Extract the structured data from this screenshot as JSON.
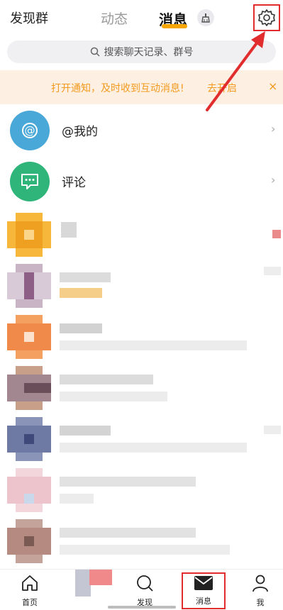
{
  "header": {
    "left_title": "发现群",
    "tab_dynamic": "动态",
    "tab_messages": "消息"
  },
  "search": {
    "placeholder": "搜索聊天记录、群号"
  },
  "notice": {
    "text": "打开通知，及时收到互动消息!",
    "link": "去开启",
    "close": "×"
  },
  "list": {
    "items": [
      {
        "label": "@我的",
        "icon": "at-icon"
      },
      {
        "label": "评论",
        "icon": "comment-icon"
      }
    ]
  },
  "bottom_nav": {
    "items": [
      {
        "label": "首页",
        "icon": "home-icon"
      },
      {
        "label": "发现",
        "icon": "search-icon"
      },
      {
        "label": "消息",
        "icon": "mail-icon"
      },
      {
        "label": "我",
        "icon": "person-icon"
      }
    ]
  },
  "colors": {
    "accent": "#f7a600",
    "notice_bg": "#fdf0e2",
    "notice_text": "#f39a1e",
    "highlight_red": "#e12d2d",
    "at_blue": "#4aa8d8",
    "comment_green": "#2fb57a"
  }
}
